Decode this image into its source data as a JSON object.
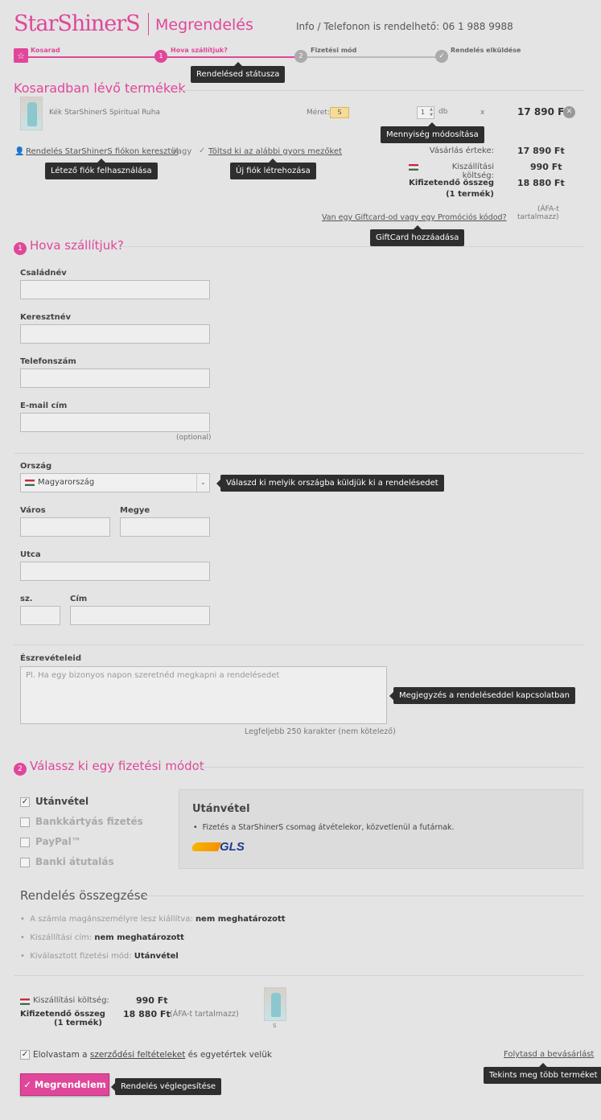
{
  "header": {
    "logo": "StarShinerS",
    "title": "Megrendelés",
    "info": "Info / Telefonon is rendelhető: 06 1 988 9988"
  },
  "steps": [
    {
      "label": "Kosarad",
      "num": ""
    },
    {
      "label": "Hova szállítjuk?",
      "num": "1"
    },
    {
      "label": "Fizetési mód",
      "num": "2"
    },
    {
      "label": "Rendelés elküldése",
      "num": ""
    }
  ],
  "tips": {
    "status": "Rendelésed státusza",
    "qty": "Mennyiség módosítása",
    "existing": "Létező fiók felhasználása",
    "newacc": "Új fiók létrehozása",
    "gift": "GiftCard hozzáadása",
    "country": "Válaszd ki melyik országba küldjük ki a rendelésedet",
    "note": "Megjegyzés a rendeléseddel kapcsolatban",
    "more": "Tekints meg több terméket",
    "finalize": "Rendelés véglegesítése"
  },
  "cart": {
    "heading": "Kosaradban lévő termékek",
    "product": "Kék StarShinerS Spiritual Ruha",
    "size_label": "Méret:",
    "size": "S",
    "qty": "1",
    "unit": "db",
    "x": "x",
    "price": "17 890  Ft"
  },
  "account": {
    "login": "Rendelés StarShinerS fiókon keresztül",
    "or": "vagy",
    "fill": "Töltsd ki az alábbi gyors mezőket"
  },
  "summary": {
    "purchase_label": "Vásárlás érteke:",
    "purchase": "17 890  Ft",
    "ship_label": "Kiszállítási költség:",
    "ship": "990  Ft",
    "total_label": "Kifizetendő összeg",
    "total_sub": "(1 termék)",
    "total": "18 880  Ft",
    "vat1": "(ÁFA-t",
    "vat2": "tartalmazz)",
    "gift": "Van egy Giftcard-od vagy egy Promóciós kódod?"
  },
  "shipping": {
    "num": "1",
    "heading": "Hova szállítjuk?",
    "lastname": "Családnév",
    "firstname": "Keresztnév",
    "phone": "Telefonszám",
    "email": "E-mail cím",
    "optional": "(optional)",
    "country": "Ország",
    "country_value": "Magyarország",
    "city": "Város",
    "county": "Megye",
    "street": "Utca",
    "no": "sz.",
    "address": "Cím",
    "notes": "Észrevételeid",
    "notes_placeholder": "Pl. Ha egy bizonyos napon szeretnéd megkapni a rendelésedet",
    "notes_hint": "Legfeljebb 250 karakter (nem kötelező)"
  },
  "payment": {
    "num": "2",
    "heading": "Válassz ki egy fizetési módot",
    "options": [
      "Utánvétel",
      "Bankkártyás fizetés",
      "PayPal™",
      "Banki átutalás"
    ],
    "selected": "Utánvétel",
    "panel_title": "Utánvétel",
    "panel_text": "Fizetés a StarShinerS csomag átvételekor, közvetlenül a futárnak.",
    "carrier": "GLS"
  },
  "order_summary": {
    "heading": "Rendelés összegzése",
    "l1": "A számla magánszemélyre lesz kiállítva:",
    "v1": "nem meghatározott",
    "l2": "Kiszállítási cím:",
    "v2": "nem meghatározott",
    "l3": "Kiválasztott fizetési mód:",
    "v3": "Utánvétel",
    "ship_label": "Kiszállítási költség:",
    "ship": "990  Ft",
    "total_label": "Kifizetendő összeg",
    "total_sub": "(1 termék)",
    "total": "18 880  Ft",
    "vat": "(ÁFA-t tartalmazz)",
    "thumb_size": "S"
  },
  "footer": {
    "terms_pre": "Elolvastam a ",
    "terms_link": "szerződési feltételeket",
    "terms_post": " és egyetértek velük",
    "continue": "Folytasd a bevásárlást",
    "submit": "✓ Megrendelem"
  },
  "colors": {
    "accent": "#e0479a",
    "tooltip": "#2e2e2e",
    "background": "#e4e4e4"
  }
}
